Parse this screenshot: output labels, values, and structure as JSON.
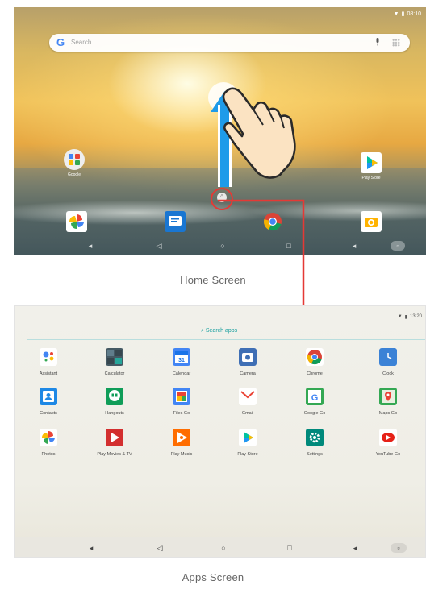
{
  "home": {
    "status_time": "08:10",
    "search_placeholder": "Search",
    "labels": {
      "google": "Google",
      "play_store": "Play Store"
    }
  },
  "captions": {
    "home": "Home Screen",
    "apps": "Apps Screen"
  },
  "apps": {
    "status_time": "13:20",
    "search_label": "Search apps",
    "items": [
      {
        "label": "Assistant",
        "icon": "assistant-icon",
        "color": "#ffffff"
      },
      {
        "label": "Calculator",
        "icon": "calculator-icon",
        "color": "#455a64"
      },
      {
        "label": "Calendar",
        "icon": "calendar-icon",
        "color": "#4285f4"
      },
      {
        "label": "Camera",
        "icon": "camera-icon",
        "color": "#3f6fb5"
      },
      {
        "label": "Chrome",
        "icon": "chrome-icon",
        "color": "#ffffff"
      },
      {
        "label": "Clock",
        "icon": "clock-icon",
        "color": "#3b82d6"
      },
      {
        "label": "Contacts",
        "icon": "contacts-icon",
        "color": "#1e88e5"
      },
      {
        "label": "Hangouts",
        "icon": "hangouts-icon",
        "color": "#0f9d58"
      },
      {
        "label": "Files Go",
        "icon": "files-go-icon",
        "color": "#4285f4"
      },
      {
        "label": "Gmail",
        "icon": "gmail-icon",
        "color": "#ffffff"
      },
      {
        "label": "Google Go",
        "icon": "google-go-icon",
        "color": "#34a853"
      },
      {
        "label": "Maps Go",
        "icon": "maps-go-icon",
        "color": "#34a853"
      },
      {
        "label": "Photos",
        "icon": "photos-icon",
        "color": "#ffffff"
      },
      {
        "label": "Play Movies & TV",
        "icon": "play-movies-icon",
        "color": "#d32f2f"
      },
      {
        "label": "Play Music",
        "icon": "play-music-icon",
        "color": "#ff6d00"
      },
      {
        "label": "Play Store",
        "icon": "play-store-icon",
        "color": "#ffffff"
      },
      {
        "label": "Settings",
        "icon": "settings-icon",
        "color": "#00897b"
      },
      {
        "label": "YouTube Go",
        "icon": "youtube-go-icon",
        "color": "#ffffff"
      }
    ]
  },
  "colors": {
    "swipe_arrow": "#1e9be9",
    "highlight": "#e53935"
  }
}
